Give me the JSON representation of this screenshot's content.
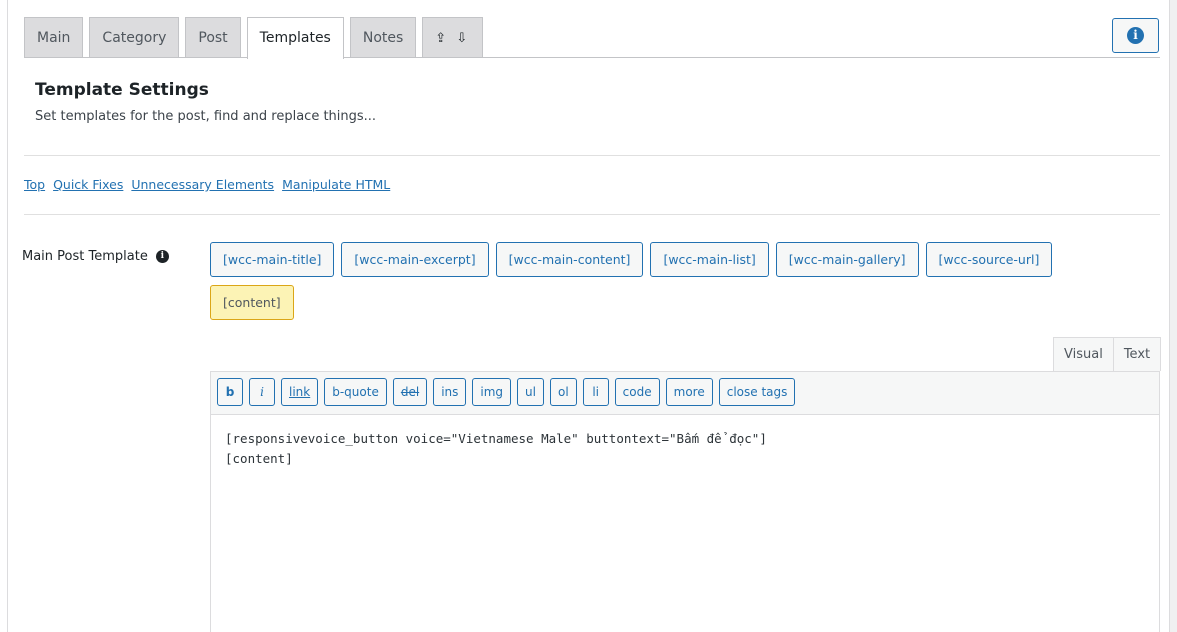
{
  "tabs": [
    {
      "label": "Main",
      "active": false
    },
    {
      "label": "Category",
      "active": false
    },
    {
      "label": "Post",
      "active": false
    },
    {
      "label": "Templates",
      "active": true
    },
    {
      "label": "Notes",
      "active": false
    }
  ],
  "import_export_icon": "⇪ ⇩",
  "info_icon": "i",
  "section": {
    "title": "Template Settings",
    "description": "Set templates for the post, find and replace things..."
  },
  "quick_links": [
    "Top",
    "Quick Fixes",
    "Unnecessary Elements",
    "Manipulate HTML"
  ],
  "field": {
    "label": "Main Post Template",
    "info_icon": "i"
  },
  "shortcodes": [
    "[wcc-main-title]",
    "[wcc-main-excerpt]",
    "[wcc-main-content]",
    "[wcc-main-list]",
    "[wcc-main-gallery]",
    "[wcc-source-url]",
    "[content]"
  ],
  "editor_modes": {
    "visual": "Visual",
    "text": "Text"
  },
  "toolbar_buttons": [
    "b",
    "i",
    "link",
    "b-quote",
    "del",
    "ins",
    "img",
    "ul",
    "ol",
    "li",
    "code",
    "more",
    "close tags"
  ],
  "editor_content": "[responsivevoice_button voice=\"Vietnamese Male\" buttontext=\"Bấm để đọc\"]\n[content]",
  "colors": {
    "accent": "#2271b1",
    "highlight": "#fcf3b5",
    "tab_inactive": "#dcdcde"
  }
}
